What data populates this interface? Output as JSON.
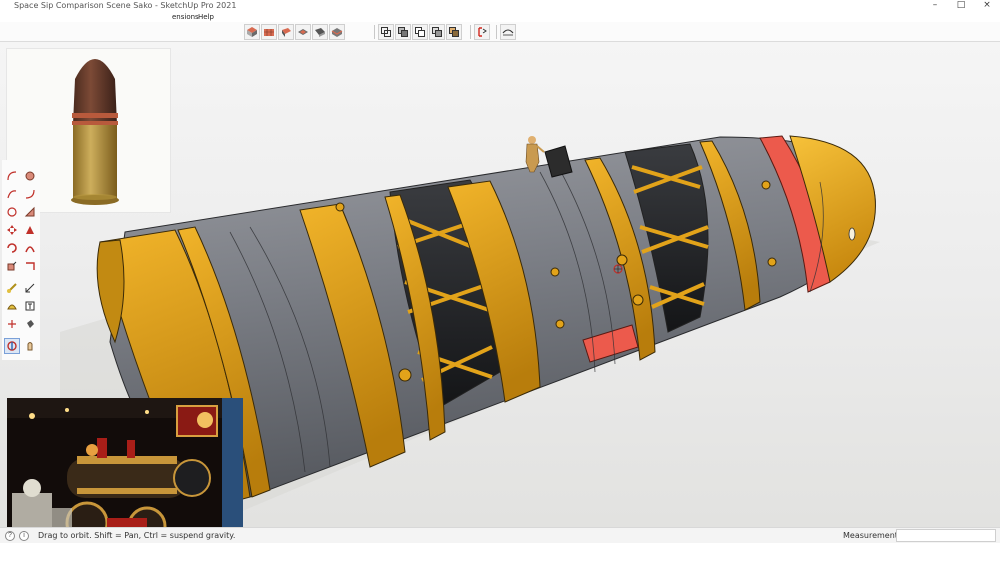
{
  "window": {
    "title": "Space Sip Comparison Scene Sako - SketchUp Pro 2021",
    "controls": [
      "–",
      "□",
      "×"
    ]
  },
  "menubar": {
    "items": [
      {
        "label": "ensions"
      },
      {
        "label": "Help"
      }
    ]
  },
  "toolbar": {
    "buttons": [
      {
        "name": "iso-view-icon"
      },
      {
        "name": "top-view-icon"
      },
      {
        "name": "front-view-icon"
      },
      {
        "name": "right-view-icon"
      },
      {
        "name": "back-view-icon"
      },
      {
        "name": "left-view-icon"
      },
      {
        "name": "xray-icon"
      },
      {
        "name": "wireframe-icon"
      },
      {
        "name": "hidden-line-icon"
      },
      {
        "name": "shaded-icon"
      },
      {
        "name": "textured-icon"
      },
      {
        "name": "section-plane-icon"
      },
      {
        "name": "section-cut-icon"
      }
    ]
  },
  "left_tools": {
    "buttons": [
      {
        "name": "arc-icon"
      },
      {
        "name": "circle-icon"
      },
      {
        "name": "freehand-icon"
      },
      {
        "name": "arc2-icon"
      },
      {
        "name": "rotated-rect-icon"
      },
      {
        "name": "pie-icon"
      },
      {
        "name": "move-icon"
      },
      {
        "name": "push-pull-icon"
      },
      {
        "name": "rotate-icon"
      },
      {
        "name": "follow-me-icon"
      },
      {
        "name": "scale-icon"
      },
      {
        "name": "offset-icon"
      },
      {
        "name": "tape-measure-icon"
      },
      {
        "name": "dimension-icon"
      },
      {
        "name": "protractor-icon"
      },
      {
        "name": "text-icon"
      },
      {
        "name": "axes-icon"
      },
      {
        "name": "paint-bucket-icon"
      },
      {
        "name": "orbit-icon"
      },
      {
        "name": "pan-icon"
      }
    ]
  },
  "colors": {
    "hull_gray": "#7c7f86",
    "band_yellow": "#e3a516",
    "nose_yellow": "#f0b21a",
    "red_stripe": "#ec5a4c"
  },
  "statusbar": {
    "hint": "Drag to orbit. Shift = Pan, Ctrl = suspend gravity.",
    "measurements_label": "Measurements",
    "measurements_value": ""
  }
}
